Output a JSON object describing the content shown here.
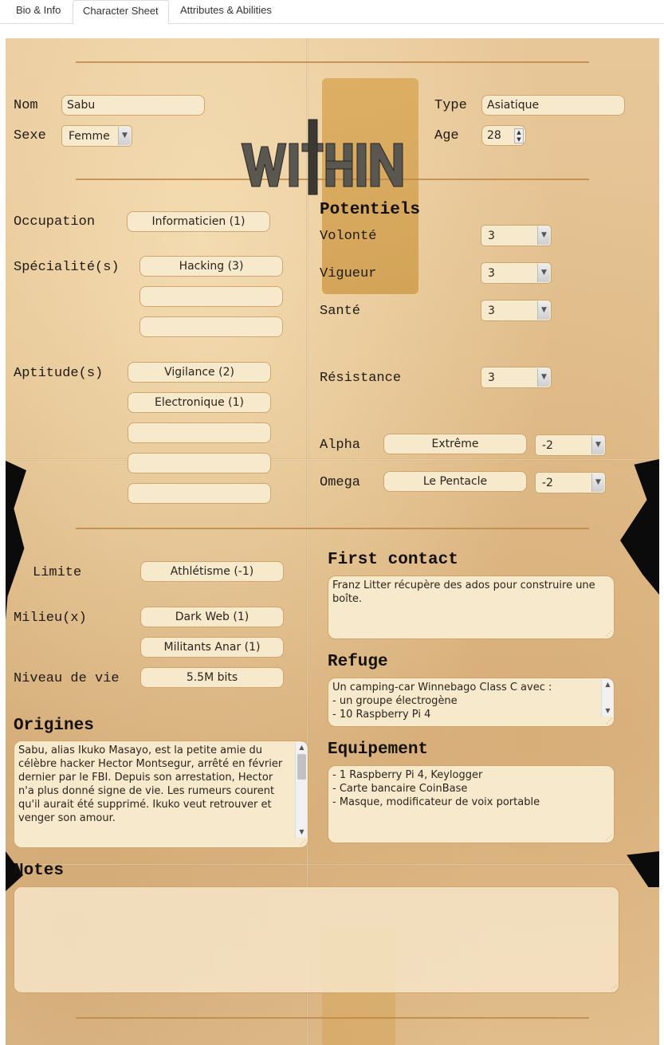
{
  "tabs": [
    "Bio & Info",
    "Character Sheet",
    "Attributes & Abilities"
  ],
  "active_tab": "Character Sheet",
  "logo": {
    "text": "WITHIN"
  },
  "identity": {
    "nom_label": "Nom",
    "nom": "Sabu",
    "sexe_label": "Sexe",
    "sexe": "Femme",
    "type_label": "Type",
    "type": "Asiatique",
    "age_label": "Age",
    "age": "28"
  },
  "left": {
    "occupation_label": "Occupation",
    "occupation": "Informaticien (1)",
    "specialite_label": "Spécialité(s)",
    "specialites": [
      "Hacking (3)",
      "",
      ""
    ],
    "aptitude_label": "Aptitude(s)",
    "aptitudes": [
      "Vigilance (2)",
      "Electronique (1)",
      "",
      "",
      ""
    ]
  },
  "potentiels": {
    "title": "Potentiels",
    "items": [
      {
        "label": "Volonté",
        "value": "3"
      },
      {
        "label": "Vigueur",
        "value": "3"
      },
      {
        "label": "Santé",
        "value": "3"
      },
      {
        "label": "Résistance",
        "value": "3"
      }
    ],
    "alpha": {
      "label": "Alpha",
      "text": "Extrême",
      "value": "-2"
    },
    "omega": {
      "label": "Omega",
      "text": "Le Pentacle",
      "value": "-2"
    }
  },
  "lower_left": {
    "limite_label": "Limite",
    "limite": "Athlétisme (-1)",
    "milieu_label": "Milieu(x)",
    "milieux": [
      "Dark Web (1)",
      "Militants Anar (1)"
    ],
    "niveau_label": "Niveau de vie",
    "niveau": "5.5M bits"
  },
  "origines": {
    "title": "Origines",
    "text": "Sabu, alias Ikuko Masayo, est la petite amie du célèbre hacker Hector Montsegur, arrêté en février dernier par le FBI. Depuis son arrestation, Hector n'a plus donné signe de vie. Les rumeurs courent qu'il aurait été supprimé. Ikuko veut retrouver et venger son amour."
  },
  "first_contact": {
    "title": "First contact",
    "text": "Franz Litter récupère des ados pour construire une boîte."
  },
  "refuge": {
    "title": "Refuge",
    "lines": [
      "Un camping-car Winnebago Class C avec :",
      "- un groupe électrogène",
      "- 10 Raspberry Pi 4"
    ]
  },
  "equipement": {
    "title": "Equipement",
    "lines": [
      "- 1 Raspberry Pi 4, Keylogger",
      "- Carte bancaire CoinBase",
      "- Masque, modificateur de voix portable"
    ]
  },
  "notes": {
    "title": "Notes",
    "text": ""
  },
  "colors": {
    "paper": "#e3c08f",
    "field": "#f7e9cc",
    "rule": "#c08a48",
    "ink": "#1e1a14"
  }
}
